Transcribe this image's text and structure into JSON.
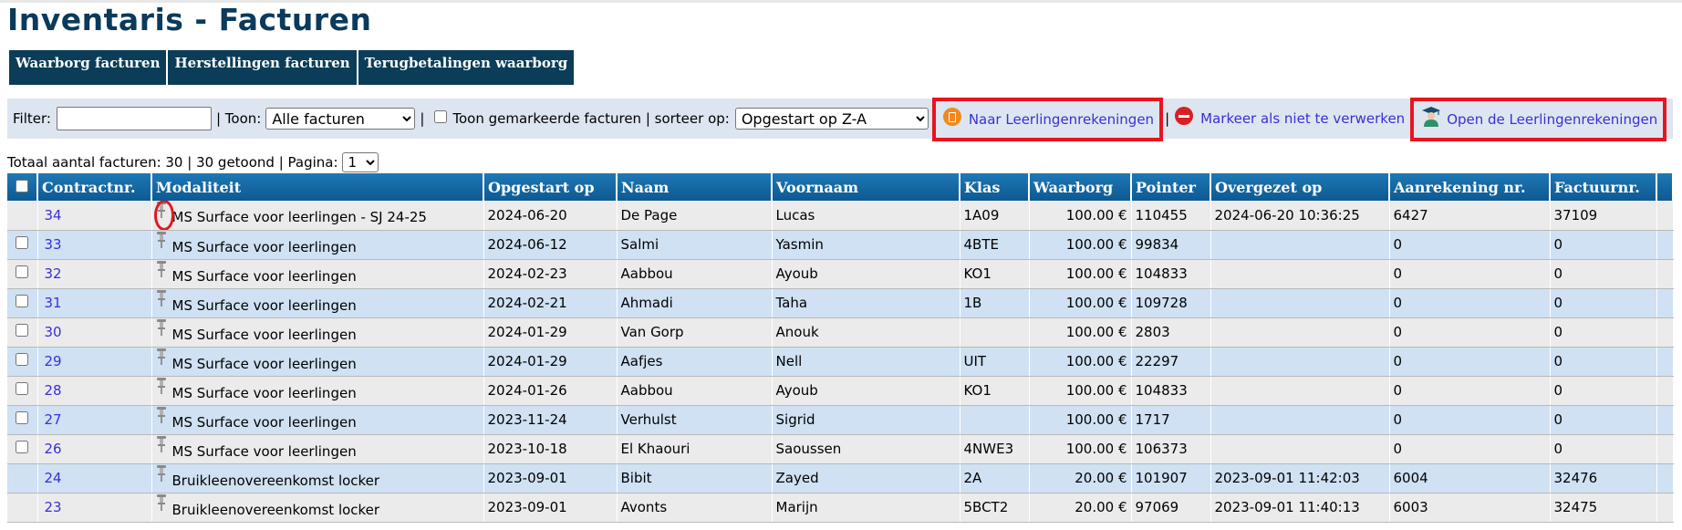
{
  "page": {
    "title": "Inventaris - Facturen"
  },
  "tabs": [
    "Waarborg facturen",
    "Herstellingen facturen",
    "Terugbetalingen waarborg"
  ],
  "filter": {
    "filter_label": "Filter:",
    "filter_value": "",
    "show_label": "| Toon:",
    "show_selected": "Alle facturen",
    "sep1": "|",
    "marked_label": "Toon gemarkeerde facturen | sorteer op:",
    "sort_selected": "Opgestart op Z-A",
    "action_leerlingen": "Naar Leerlingenrekeningen",
    "sep2": "|",
    "action_markeer": "Markeer als niet te verwerken",
    "action_open": "Open de Leerlingenrekeningen"
  },
  "summary": {
    "text": "Totaal aantal facturen: 30 | 30 getoond | Pagina:",
    "page": "1"
  },
  "table": {
    "headers": [
      "Contractnr.",
      "Modaliteit",
      "Opgestart op",
      "Naam",
      "Voornaam",
      "Klas",
      "Waarborg",
      "Pointer",
      "Overgezet op",
      "Aanrekening nr.",
      "Factuurnr."
    ],
    "rows": [
      {
        "checkbox": false,
        "contract": "34",
        "modaliteit": "MS Surface voor leerlingen - SJ 24-25",
        "opgestart": "2024-06-20",
        "naam": "De Page",
        "voornaam": "Lucas",
        "klas": "1A09",
        "waarborg": "100.00 €",
        "pointer": "110455",
        "overgezet": "2024-06-20 10:36:25",
        "aanrekening": "6427",
        "factuur": "37109"
      },
      {
        "checkbox": true,
        "contract": "33",
        "modaliteit": "MS Surface voor leerlingen",
        "opgestart": "2024-06-12",
        "naam": "Salmi",
        "voornaam": "Yasmin",
        "klas": "4BTE",
        "waarborg": "100.00 €",
        "pointer": "99834",
        "overgezet": "",
        "aanrekening": "0",
        "factuur": "0"
      },
      {
        "checkbox": true,
        "contract": "32",
        "modaliteit": "MS Surface voor leerlingen",
        "opgestart": "2024-02-23",
        "naam": "Aabbou",
        "voornaam": "Ayoub",
        "klas": "KO1",
        "waarborg": "100.00 €",
        "pointer": "104833",
        "overgezet": "",
        "aanrekening": "0",
        "factuur": "0"
      },
      {
        "checkbox": true,
        "contract": "31",
        "modaliteit": "MS Surface voor leerlingen",
        "opgestart": "2024-02-21",
        "naam": "Ahmadi",
        "voornaam": "Taha",
        "klas": "1B",
        "waarborg": "100.00 €",
        "pointer": "109728",
        "overgezet": "",
        "aanrekening": "0",
        "factuur": "0"
      },
      {
        "checkbox": true,
        "contract": "30",
        "modaliteit": "MS Surface voor leerlingen",
        "opgestart": "2024-01-29",
        "naam": "Van Gorp",
        "voornaam": "Anouk",
        "klas": "",
        "waarborg": "100.00 €",
        "pointer": "2803",
        "overgezet": "",
        "aanrekening": "0",
        "factuur": "0"
      },
      {
        "checkbox": true,
        "contract": "29",
        "modaliteit": "MS Surface voor leerlingen",
        "opgestart": "2024-01-29",
        "naam": "Aafjes",
        "voornaam": "Nell",
        "klas": "UIT",
        "waarborg": "100.00 €",
        "pointer": "22297",
        "overgezet": "",
        "aanrekening": "0",
        "factuur": "0"
      },
      {
        "checkbox": true,
        "contract": "28",
        "modaliteit": "MS Surface voor leerlingen",
        "opgestart": "2024-01-26",
        "naam": "Aabbou",
        "voornaam": "Ayoub",
        "klas": "KO1",
        "waarborg": "100.00 €",
        "pointer": "104833",
        "overgezet": "",
        "aanrekening": "0",
        "factuur": "0"
      },
      {
        "checkbox": true,
        "contract": "27",
        "modaliteit": "MS Surface voor leerlingen",
        "opgestart": "2023-11-24",
        "naam": "Verhulst",
        "voornaam": "Sigrid",
        "klas": "",
        "waarborg": "100.00 €",
        "pointer": "1717",
        "overgezet": "",
        "aanrekening": "0",
        "factuur": "0"
      },
      {
        "checkbox": true,
        "contract": "26",
        "modaliteit": "MS Surface voor leerlingen",
        "opgestart": "2023-10-18",
        "naam": "El Khaouri",
        "voornaam": "Saoussen",
        "klas": "4NWE3",
        "waarborg": "100.00 €",
        "pointer": "106373",
        "overgezet": "",
        "aanrekening": "0",
        "factuur": "0"
      },
      {
        "checkbox": false,
        "contract": "24",
        "modaliteit": "Bruikleenovereenkomst locker",
        "opgestart": "2023-09-01",
        "naam": "Bibit",
        "voornaam": "Zayed",
        "klas": "2A",
        "waarborg": "20.00 €",
        "pointer": "101907",
        "overgezet": "2023-09-01 11:42:03",
        "aanrekening": "6004",
        "factuur": "32476"
      },
      {
        "checkbox": false,
        "contract": "23",
        "modaliteit": "Bruikleenovereenkomst locker",
        "opgestart": "2023-09-01",
        "naam": "Avonts",
        "voornaam": "Marijn",
        "klas": "5BCT2",
        "waarborg": "20.00 €",
        "pointer": "97069",
        "overgezet": "2023-09-01 11:40:13",
        "aanrekening": "6003",
        "factuur": "32475"
      }
    ]
  },
  "colors": {
    "title": "#0a3a5c",
    "tab_bg": "#0b3d58",
    "header_bg": "#1773b0",
    "row_odd": "#ebebeb",
    "row_even": "#cfe1f3",
    "link": "#3a2fd8",
    "highlight": "#e8141f"
  },
  "icons": {
    "modaliteit": "pushpin-icon",
    "leerlingen": "invoice-icon",
    "markeer": "no-entry-icon",
    "open": "student-icon"
  }
}
